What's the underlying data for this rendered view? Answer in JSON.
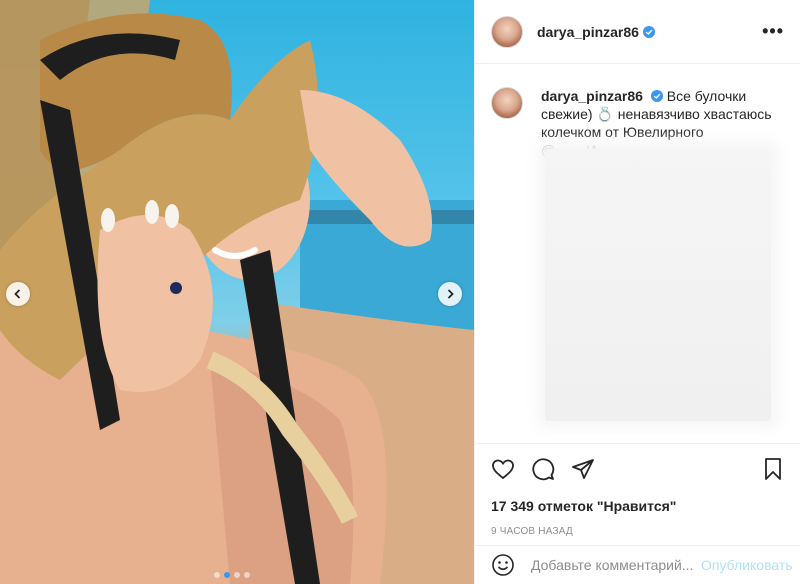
{
  "post": {
    "username": "darya_pinzar86",
    "verified_icon": "verified-badge-icon",
    "more_icon": "more-options-icon",
    "caption_lines": [
      "Все булочки",
      "свежие) 💍 ненавязчиво хвастаюсь",
      "колечком от Ювелирного"
    ],
    "caption_faded": "@...  ...  И"
  },
  "photo": {
    "prev_icon": "chevron-left-icon",
    "next_icon": "chevron-right-icon",
    "carousel_dots": 4,
    "active_dot": 1
  },
  "actions": {
    "like_icon": "heart-icon",
    "comment_icon": "comment-icon",
    "share_icon": "share-icon",
    "save_icon": "bookmark-icon",
    "likes_text": "17 349 отметок \"Нравится\"",
    "time_text": "9 часов назад"
  },
  "comment_box": {
    "emoji_icon": "emoji-icon",
    "placeholder": "Добавьте комментарий...",
    "publish_label": "Опубликовать"
  },
  "colors": {
    "accent": "#3897f0",
    "publish_disabled": "#b2dffc",
    "border": "#efefef"
  }
}
